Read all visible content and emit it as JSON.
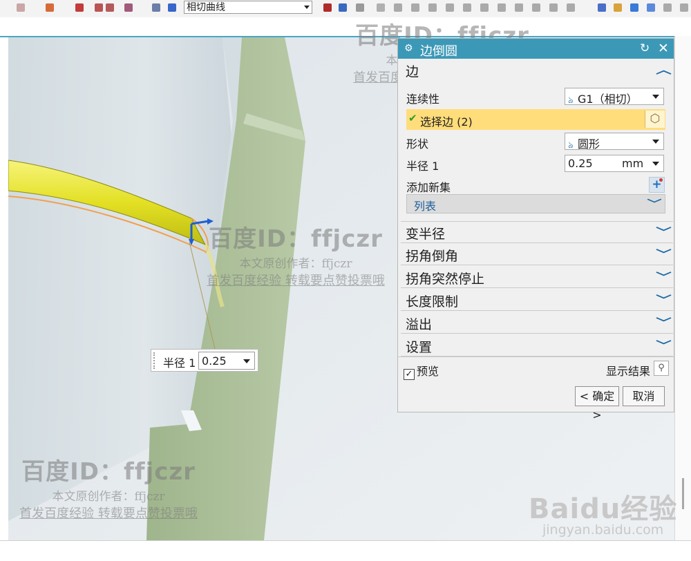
{
  "toolbar": {
    "curve_rule_value": "相切曲线"
  },
  "dialog": {
    "title": "边倒圆",
    "edge_section": {
      "label": "边",
      "continuity_label": "连续性",
      "continuity_value": "G1（相切）",
      "select_edge_label": "选择边 (2)",
      "shape_label": "形状",
      "shape_value": "圆形",
      "radius_label": "半径 1",
      "radius_value": "0.25",
      "radius_unit": "mm",
      "add_new_set_label": "添加新集",
      "list_label": "列表"
    },
    "sections": [
      {
        "label": "变半径"
      },
      {
        "label": "拐角倒角"
      },
      {
        "label": "拐角突然停止"
      },
      {
        "label": "长度限制"
      },
      {
        "label": "溢出"
      },
      {
        "label": "设置"
      }
    ],
    "preview_label": "预览",
    "preview_checked": true,
    "show_result_label": "显示结果",
    "ok_label": "< 确定 >",
    "cancel_label": "取消"
  },
  "onscreen_input": {
    "label": "半径 1",
    "value": "0.25"
  },
  "watermarks": [
    {
      "line1": "百度ID：ffjczr",
      "line2": "本文原创作者：ffjczr",
      "line3": "首发百度经验 转载要点赞投票哦"
    },
    {
      "line1": "百度ID：ffjczr",
      "line2": "本文原创作者：ffjczr",
      "line3": "首发百度经验 转载要点赞投票哦"
    },
    {
      "line1": "百度ID：ffjczr",
      "line2": "本文原创作者：ffjczr",
      "line3": "首发百度经验 转载要点赞投票哦"
    }
  ],
  "baidu_logo": {
    "text": "Baidu经验",
    "url_text": "jingyan.baidu.com"
  },
  "colors": {
    "title_bar": "#3c98b7",
    "selection_highlight": "#ffdd7a",
    "chevron": "#1b6aa6",
    "fillet_yellow": "#e8e62a"
  }
}
